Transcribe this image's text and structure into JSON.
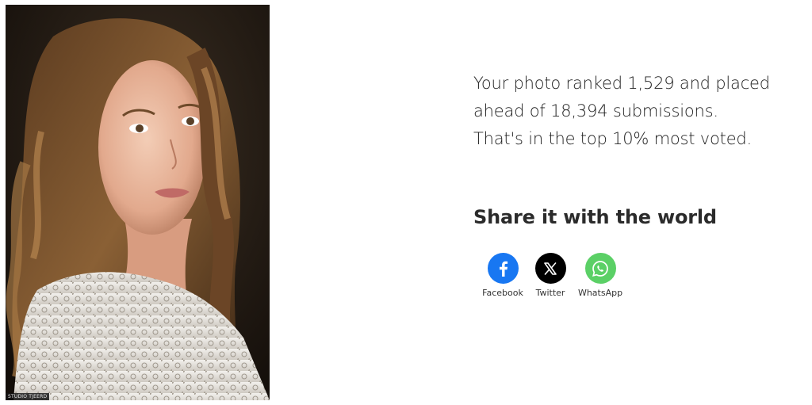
{
  "photo": {
    "alt": "Portrait of a girl with long wavy hair in a white lace top",
    "watermark": "STUDIO TJEERD"
  },
  "stats": {
    "line1": "Your photo ranked 1,529 and placed",
    "line2": "ahead of 18,394 submissions.",
    "line3": "That's in the top 10% most voted."
  },
  "share": {
    "heading": "Share it with the world",
    "buttons": [
      {
        "label": "Facebook",
        "icon": "facebook-icon",
        "color": "#1877f2"
      },
      {
        "label": "Twitter",
        "icon": "x-icon",
        "color": "#000000"
      },
      {
        "label": "WhatsApp",
        "icon": "whatsapp-icon",
        "color": "#5bd066"
      }
    ]
  }
}
